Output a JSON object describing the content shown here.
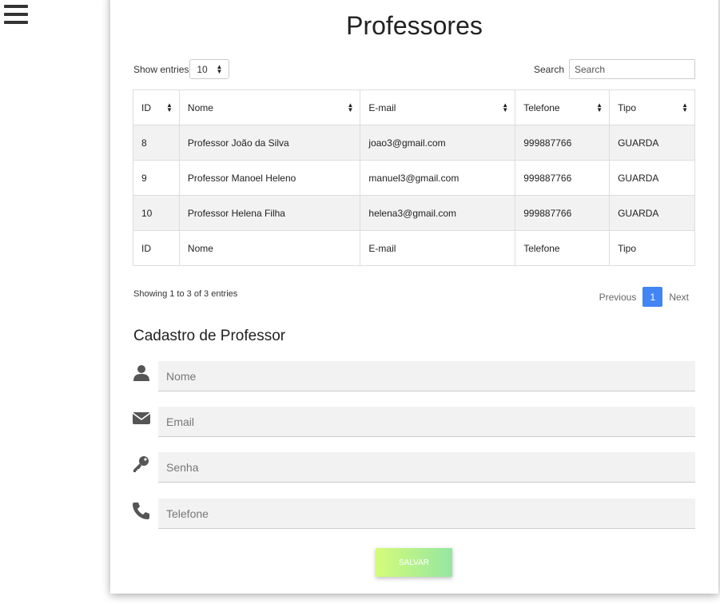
{
  "page": {
    "title": "Professores"
  },
  "table_controls": {
    "show_entries_label": "Show entries",
    "entries_value": "10",
    "search_label": "Search",
    "search_placeholder": "Search"
  },
  "table": {
    "columns": [
      "ID",
      "Nome",
      "E-mail",
      "Telefone",
      "Tipo"
    ],
    "rows": [
      [
        "8",
        "Professor João da Silva",
        "joao3@gmail.com",
        "999887766",
        "GUARDA"
      ],
      [
        "9",
        "Professor Manoel Heleno",
        "manuel3@gmail.com",
        "999887766",
        "GUARDA"
      ],
      [
        "10",
        "Professor Helena Filha",
        "helena3@gmail.com",
        "999887766",
        "GUARDA"
      ]
    ],
    "footer": [
      "ID",
      "Nome",
      "E-mail",
      "Telefone",
      "Tipo"
    ]
  },
  "table_info": {
    "showing": "Showing 1 to 3 of 3 entries",
    "previous": "Previous",
    "current_page": "1",
    "next": "Next"
  },
  "form": {
    "title": "Cadastro de Professor",
    "fields": [
      {
        "placeholder": "Nome",
        "icon": "user-icon"
      },
      {
        "placeholder": "Email",
        "icon": "envelope-icon"
      },
      {
        "placeholder": "Senha",
        "icon": "key-icon"
      },
      {
        "placeholder": "Telefone",
        "icon": "phone-icon"
      }
    ],
    "submit_label": "SALVAR"
  },
  "colors": {
    "accent": "#4285f4",
    "button_gradient_start": "#d4fc79",
    "button_gradient_end": "#96e6a1",
    "icon": "#555555"
  }
}
